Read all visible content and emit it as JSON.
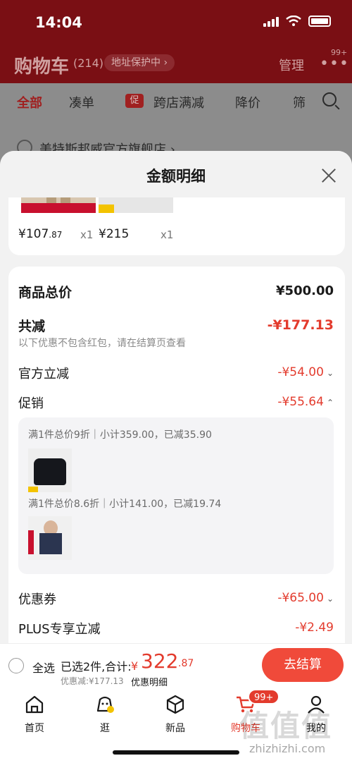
{
  "status": {
    "time": "14:04"
  },
  "header": {
    "title": "购物车",
    "count": "(214)",
    "address_pill": "地址保护中 ›",
    "manage": "管理",
    "more": "•••",
    "more_badge": "99+"
  },
  "filter_tabs": [
    {
      "label": "全部",
      "active": true
    },
    {
      "label": "凑单"
    },
    {
      "label": "跨店满减",
      "badge": "促"
    },
    {
      "label": "降价"
    },
    {
      "label": "筛"
    }
  ],
  "store": {
    "name": "美特斯邦威官方旗舰店 ›"
  },
  "modal": {
    "title": "金额明细",
    "products": [
      {
        "price": "¥107",
        "price_decimal": ".87",
        "qty": "x1"
      },
      {
        "price": "¥215",
        "price_decimal": "",
        "qty": "x1"
      }
    ],
    "rows": {
      "total_label": "商品总价",
      "total_value": "¥500.00",
      "reduce_label": "共减",
      "reduce_value": "-¥177.13",
      "reduce_note": "以下优惠不包含红包，请在结算页查看",
      "official_label": "官方立减",
      "official_value": "-¥54.00",
      "promo_label": "促销",
      "promo_value": "-¥55.64",
      "coupon_label": "优惠券",
      "coupon_value": "-¥65.00",
      "plus_label": "PLUS专享立减",
      "plus_value": "-¥2.49"
    },
    "promos": [
      {
        "text": "满1件总价9折｜小计359.00，已减35.90"
      },
      {
        "text": "满1件总价8.6折｜小计141.00，已减19.74"
      }
    ]
  },
  "checkout": {
    "select_all": "全选",
    "selected": "已选2件,合计:",
    "currency": "¥",
    "total_int": "322",
    "total_dec": ".87",
    "saved": "优惠减:¥177.13",
    "detail_link": "优惠明细",
    "pay_button": "去结算"
  },
  "tabbar": [
    {
      "label": "首页",
      "icon": "home-icon"
    },
    {
      "label": "逛",
      "icon": "browse-icon"
    },
    {
      "label": "新品",
      "icon": "box-icon"
    },
    {
      "label": "购物车",
      "icon": "cart-icon",
      "active": true,
      "badge": "99+"
    },
    {
      "label": "我的",
      "icon": "user-icon"
    }
  ],
  "watermark": {
    "text": "值值值",
    "url": "zhizhizhi.com"
  },
  "colors": {
    "accent": "#e33b2d",
    "header_bg": "#7a0f14"
  }
}
